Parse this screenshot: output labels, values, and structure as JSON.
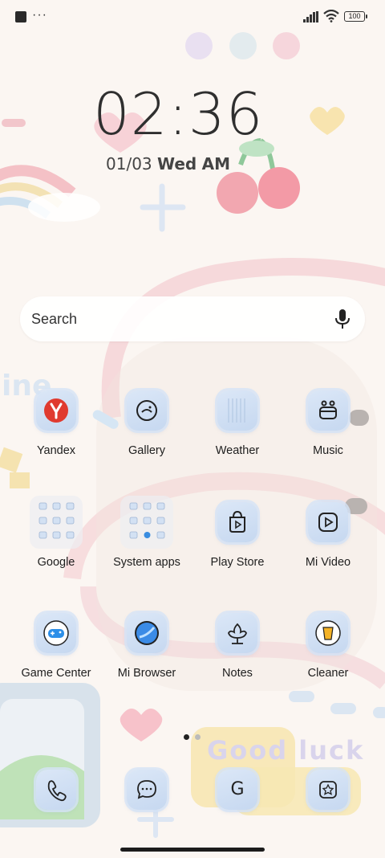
{
  "status_bar": {
    "more": "···",
    "battery": "100"
  },
  "clock": {
    "time": "02:36",
    "date": "01/03",
    "weekday": "Wed",
    "ampm": "AM"
  },
  "search": {
    "placeholder": "Search"
  },
  "apps": [
    {
      "label": "Yandex",
      "icon": "yandex-icon"
    },
    {
      "label": "Gallery",
      "icon": "gallery-icon"
    },
    {
      "label": "Weather",
      "icon": "weather-icon"
    },
    {
      "label": "Music",
      "icon": "music-icon"
    },
    {
      "label": "Google",
      "icon": "google-folder-icon"
    },
    {
      "label": "System apps",
      "icon": "system-apps-folder-icon"
    },
    {
      "label": "Play Store",
      "icon": "play-store-icon"
    },
    {
      "label": "Mi Video",
      "icon": "mi-video-icon"
    },
    {
      "label": "Game Center",
      "icon": "game-center-icon"
    },
    {
      "label": "Mi Browser",
      "icon": "mi-browser-icon"
    },
    {
      "label": "Notes",
      "icon": "notes-icon"
    },
    {
      "label": "Cleaner",
      "icon": "cleaner-icon"
    }
  ],
  "dock": [
    {
      "icon": "phone-icon"
    },
    {
      "icon": "messages-icon"
    },
    {
      "icon": "google-app-icon",
      "letter": "G"
    },
    {
      "icon": "settings-icon"
    }
  ],
  "wallpaper_text": "Good luck",
  "page_indicator": {
    "pages": 2,
    "current": 1
  },
  "colors": {
    "background": "#fbf6f2",
    "icon_tint": "#c9dbf2",
    "accent_red": "#e03a2f"
  }
}
